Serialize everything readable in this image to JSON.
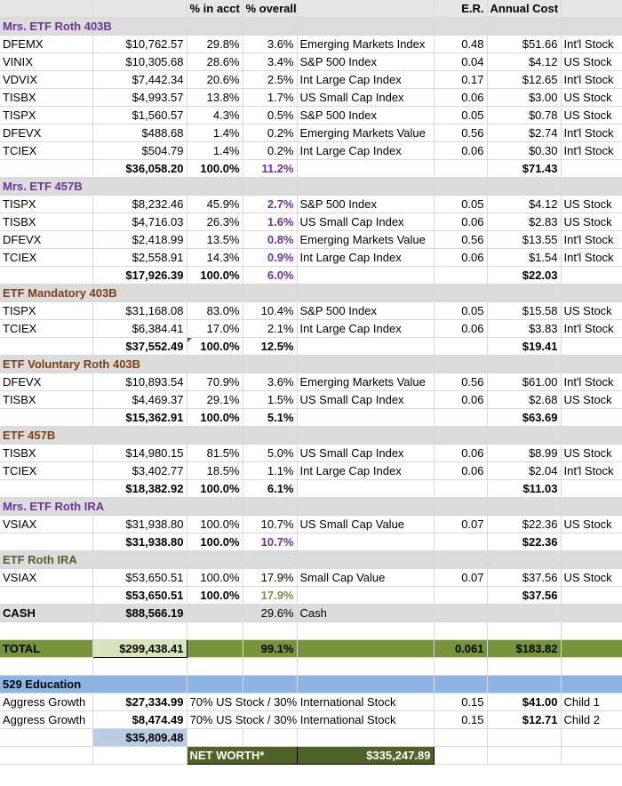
{
  "header": {
    "pct_acct": "% in acct",
    "pct_overall": "% overall",
    "er": "E.R.",
    "annual_cost": "Annual Cost"
  },
  "sections": [
    {
      "title": "Mrs. ETF Roth 403B",
      "color": "purple",
      "rows": [
        [
          "DFEMX",
          "$10,762.57",
          "29.8%",
          "3.6%",
          "Emerging Markets Index",
          "0.48",
          "$51.66",
          "Int'l Stock"
        ],
        [
          "VINIX",
          "$10,305.68",
          "28.6%",
          "3.4%",
          "S&P 500 Index",
          "0.04",
          "$4.12",
          "US Stock"
        ],
        [
          "VDVIX",
          "$7,442.34",
          "20.6%",
          "2.5%",
          "Int Large Cap  Index",
          "0.17",
          "$12.65",
          "Int'l Stock"
        ],
        [
          "TISBX",
          "$4,993.57",
          "13.8%",
          "1.7%",
          "US Small Cap Index",
          "0.06",
          "$3.00",
          "US Stock"
        ],
        [
          "TISPX",
          "$1,560.57",
          "4.3%",
          "0.5%",
          "S&P 500 Index",
          "0.05",
          "$0.78",
          "US Stock"
        ],
        [
          "DFEVX",
          "$488.68",
          "1.4%",
          "0.2%",
          "Emerging Markets Value",
          "0.56",
          "$2.74",
          "Int'l Stock"
        ],
        [
          "TCIEX",
          "$504.79",
          "1.4%",
          "0.2%",
          "Int Large Cap  Index",
          "0.06",
          "$0.30",
          "Int'l Stock"
        ]
      ],
      "subtotal": [
        "$36,058.20",
        "100.0%",
        "11.2%",
        "$71.43"
      ]
    },
    {
      "title": "Mrs. ETF 457B",
      "color": "purple",
      "rows": [
        [
          "TISPX",
          "$8,232.46",
          "45.9%",
          "2.7%",
          "S&P 500 Index",
          "0.05",
          "$4.12",
          "US Stock"
        ],
        [
          "TISBX",
          "$4,716.03",
          "26.3%",
          "1.6%",
          "US Small Cap Index",
          "0.06",
          "$2.83",
          "US Stock"
        ],
        [
          "DFEVX",
          "$2,418.99",
          "13.5%",
          "0.8%",
          "Emerging Markets Value",
          "0.56",
          "$13.55",
          "Int'l Stock"
        ],
        [
          "TCIEX",
          "$2,558.91",
          "14.3%",
          "0.9%",
          "Int Large Cap  Index",
          "0.06",
          "$1.54",
          "Int'l Stock"
        ]
      ],
      "subtotal": [
        "$17,926.39",
        "100.0%",
        "6.0%",
        "$22.03"
      ]
    },
    {
      "title": "ETF Mandatory 403B",
      "color": "maroon",
      "rows": [
        [
          "TISPX",
          "$31,168.08",
          "83.0%",
          "10.4%",
          "S&P 500 Index",
          "0.05",
          "$15.58",
          "US Stock"
        ],
        [
          "TCIEX",
          "$6,384.41",
          "17.0%",
          "2.1%",
          "Int Large Cap  Index",
          "0.06",
          "$3.83",
          "Int'l Stock"
        ]
      ],
      "subtotal": [
        "$37,552.49",
        "100.0%",
        "12.5%",
        "$19.41"
      ]
    },
    {
      "title": "ETF Voluntary Roth 403B",
      "color": "maroon",
      "rows": [
        [
          "DFEVX",
          "$10,893.54",
          "70.9%",
          "3.6%",
          "Emerging Markets Value",
          "0.56",
          "$61.00",
          "Int'l Stock"
        ],
        [
          "TISBX",
          "$4,469.37",
          "29.1%",
          "1.5%",
          "US Small Cap Index",
          "0.06",
          "$2.68",
          "US Stock"
        ]
      ],
      "subtotal": [
        "$15,362.91",
        "100.0%",
        "5.1%",
        "$63.69"
      ]
    },
    {
      "title": "ETF 457B",
      "color": "maroon",
      "rows": [
        [
          "TISBX",
          "$14,980.15",
          "81.5%",
          "5.0%",
          "US Small Cap Index",
          "0.06",
          "$8.99",
          "US Stock"
        ],
        [
          "TCIEX",
          "$3,402.77",
          "18.5%",
          "1.1%",
          "Int Large Cap  Index",
          "0.06",
          "$2.04",
          "Int'l Stock"
        ]
      ],
      "subtotal": [
        "$18,382.92",
        "100.0%",
        "6.1%",
        "$11.03"
      ]
    },
    {
      "title": "Mrs. ETF Roth IRA",
      "color": "purple",
      "rows": [
        [
          "VSIAX",
          "$31,938.80",
          "100.0%",
          "10.7%",
          "US Small Cap Value",
          "0.07",
          "$22.36",
          "US Stock"
        ]
      ],
      "subtotal": [
        "$31,938.80",
        "100.0%",
        "10.7%",
        "$22.36"
      ]
    },
    {
      "title": "ETF Roth IRA",
      "color": "olive",
      "rows": [
        [
          "VSIAX",
          "$53,650.51",
          "100.0%",
          "17.9%",
          "Small Cap Value",
          "0.07",
          "$37.56",
          "US Stock"
        ]
      ],
      "subtotal": [
        "$53,650.51",
        "100.0%",
        "17.9%",
        "$37.56"
      ]
    }
  ],
  "cash": {
    "label": "CASH",
    "amount": "$88,566.19",
    "pct": "29.6%",
    "desc": "Cash"
  },
  "total": {
    "label": "TOTAL",
    "amount": "$299,438.41",
    "pct": "99.1%",
    "er": "0.061",
    "cost": "$183.82"
  },
  "education": {
    "title": "529 Education",
    "rows": [
      [
        "Aggress Growth",
        "$27,334.99",
        "70% US Stock / 30% International Stock",
        "0.15",
        "$41.00",
        "Child 1"
      ],
      [
        "Aggress Growth",
        "$8,474.49",
        "70% US Stock / 30% International Stock",
        "0.15",
        "$12.71",
        "Child 2"
      ]
    ],
    "subtotal": "$35,809.48"
  },
  "net_worth": {
    "label": "NET WORTH*",
    "value": "$335,247.89"
  },
  "colors": {
    "purple": "#7030a0",
    "maroon": "#843c0c",
    "olive": "#4f6228",
    "total_band": "#77933c",
    "edu_band": "#8eb4e3"
  }
}
